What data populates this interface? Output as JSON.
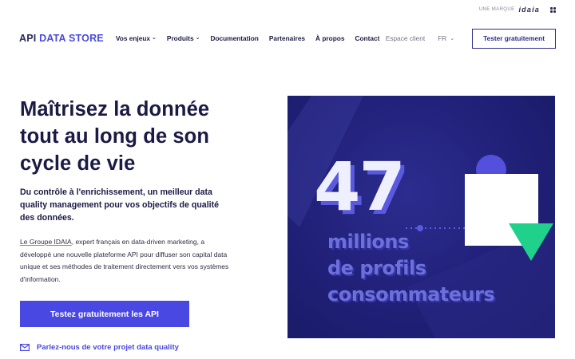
{
  "brand": {
    "small": "UNE MARQUE",
    "mark": "idaia"
  },
  "header": {
    "logo_a": "API",
    "logo_b": "DATA STORE",
    "nav": [
      {
        "label": "Vos enjeux",
        "dropdown": true
      },
      {
        "label": "Produits",
        "dropdown": true
      },
      {
        "label": "Documentation",
        "dropdown": false
      },
      {
        "label": "Partenaires",
        "dropdown": false
      },
      {
        "label": "À propos",
        "dropdown": false
      },
      {
        "label": "Contact",
        "dropdown": false
      }
    ],
    "espace_client": "Espace client",
    "lang": "FR",
    "cta": "Tester gratuitement"
  },
  "hero": {
    "title": "Maîtrisez la donnée tout au long de son cycle de vie",
    "subtitle": "Du contrôle à l'enrichissement, un meilleur data quality management pour vos objectifs de qualité des données.",
    "body_link": "Le Groupe IDAIA",
    "body_rest": ", expert français en data-driven marketing, a développé une nouvelle plateforme API pour diffuser son capital data unique et ses méthodes de traitement directement vers vos systèmes d'information.",
    "primary_button": "Testez gratuitement les API",
    "contact_link": "Parlez-nous de votre projet data quality"
  },
  "visual": {
    "number": "47",
    "line1": "millions",
    "line2": "de profils",
    "line3": "consommateurs"
  },
  "colors": {
    "accent": "#4a48e2",
    "navy": "#1b1a44",
    "panel": "#1f1f76",
    "green": "#1fd18a"
  }
}
